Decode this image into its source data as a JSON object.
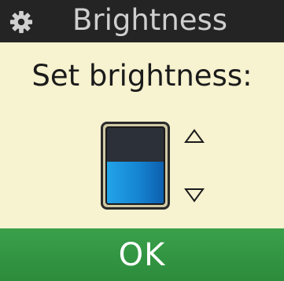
{
  "header": {
    "title": "Brightness",
    "icon": "gear-icon"
  },
  "prompt": "Set brightness:",
  "brightness": {
    "level": 0.55
  },
  "controls": {
    "increase_icon": "triangle-up-icon",
    "decrease_icon": "triangle-down-icon"
  },
  "ok_button": {
    "label": "OK"
  },
  "colors": {
    "background": "#f7f2cf",
    "header": "#242424",
    "ok": "#339644",
    "fill": "#1585d2"
  }
}
